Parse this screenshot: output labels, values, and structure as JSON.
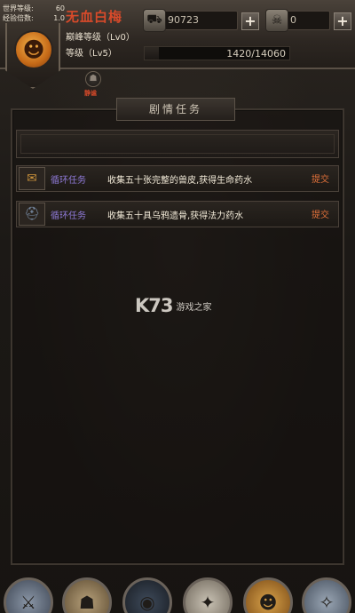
{
  "world": {
    "world_level_label": "世界等级:",
    "world_level_value": "60",
    "exp_multiplier_label": "经验倍数:",
    "exp_multiplier_value": "1.0"
  },
  "player": {
    "name": "无血白梅",
    "peak_level": "巅峰等级（Lv0）",
    "level": "等级（Lv5）",
    "exp_text": "1420/14060",
    "exp_progress": 0.101
  },
  "resources": {
    "currency_1": "90723",
    "currency_2": "0",
    "plus_1": "+",
    "plus_2": "+"
  },
  "badge": {
    "label": "静谧"
  },
  "panel": {
    "tab_title": "剧情任务"
  },
  "quests": [
    {
      "type": "循环任务",
      "desc": "收集五十张完整的兽皮,获得生命药水",
      "action": "提交",
      "icon": "scroll-icon"
    },
    {
      "type": "循环任务",
      "desc": "收集五十具乌鸦遗骨,获得法力药水",
      "action": "提交",
      "icon": "helmet-icon"
    }
  ],
  "watermark": {
    "brand": "K73",
    "site": "游戏之家"
  },
  "bottom_nav": [
    {
      "icon": "warrior-icon"
    },
    {
      "icon": "bag-icon"
    },
    {
      "icon": "portal-icon"
    },
    {
      "icon": "skill-icon"
    },
    {
      "icon": "character-icon"
    },
    {
      "icon": "map-icon"
    }
  ],
  "colors": {
    "name": "#d84a2a",
    "quest_type": "#8f7ad8",
    "submit": "#e0703a"
  }
}
